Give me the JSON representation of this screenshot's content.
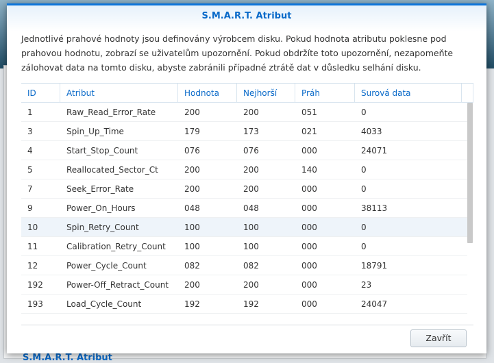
{
  "background": {
    "title": "S.M.A.R.T. Atribut"
  },
  "dialog": {
    "title": "S.M.A.R.T. Atribut",
    "description": "Jednotlivé prahové hodnoty jsou definovány výrobcem disku. Pokud hodnota atributu poklesne pod prahovou hodnotu, zobrazí se uživatelům upozornění. Pokud obdržíte toto upozornění, nezapomeňte zálohovat data na tomto disku, abyste zabránili případné ztrátě dat v důsledku selhání disku.",
    "columns": [
      "ID",
      "Atribut",
      "Hodnota",
      "Nejhorší",
      "Práh",
      "Surová data"
    ],
    "rows": [
      [
        "1",
        "Raw_Read_Error_Rate",
        "200",
        "200",
        "051",
        "0"
      ],
      [
        "3",
        "Spin_Up_Time",
        "179",
        "173",
        "021",
        "4033"
      ],
      [
        "4",
        "Start_Stop_Count",
        "076",
        "076",
        "000",
        "24071"
      ],
      [
        "5",
        "Reallocated_Sector_Ct",
        "200",
        "200",
        "140",
        "0"
      ],
      [
        "7",
        "Seek_Error_Rate",
        "200",
        "200",
        "000",
        "0"
      ],
      [
        "9",
        "Power_On_Hours",
        "048",
        "048",
        "000",
        "38113"
      ],
      [
        "10",
        "Spin_Retry_Count",
        "100",
        "100",
        "000",
        "0"
      ],
      [
        "11",
        "Calibration_Retry_Count",
        "100",
        "100",
        "000",
        "0"
      ],
      [
        "12",
        "Power_Cycle_Count",
        "082",
        "082",
        "000",
        "18791"
      ],
      [
        "192",
        "Power-Off_Retract_Count",
        "200",
        "200",
        "000",
        "23"
      ],
      [
        "193",
        "Load_Cycle_Count",
        "192",
        "192",
        "000",
        "24047"
      ]
    ],
    "selected_row": 6,
    "close_label": "Zavřít"
  }
}
